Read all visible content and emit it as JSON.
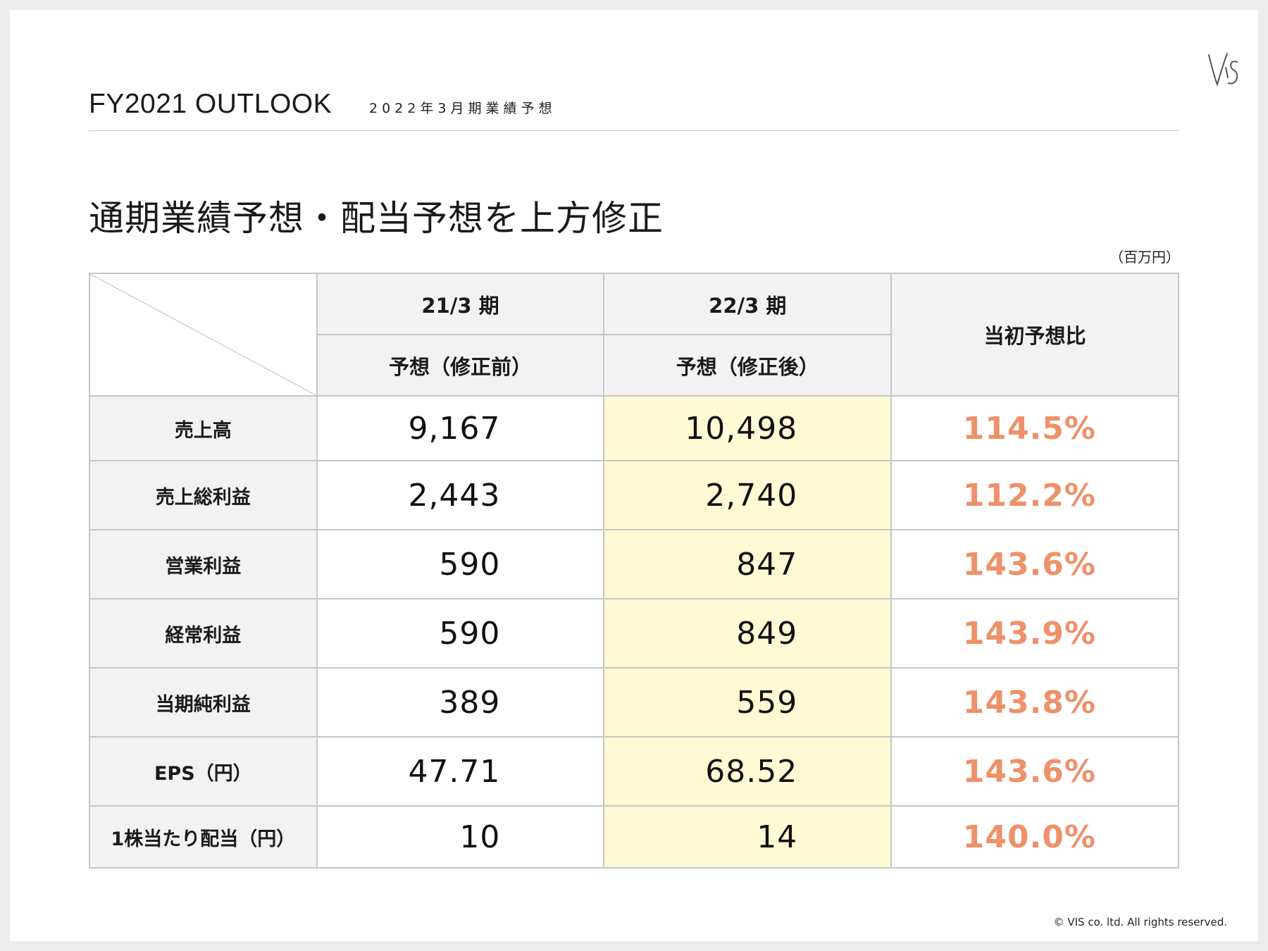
{
  "header": {
    "title_en": "FY2021 OUTLOOK",
    "title_jp": "2022年3月期業績予想"
  },
  "headline": "通期業績予想・配当予想を上方修正",
  "unit": "（百万円）",
  "table": {
    "col1_top": "21/3 期",
    "col1_sub": "予想（修正前）",
    "col2_top": "22/3 期",
    "col2_sub": "予想（修正後）",
    "col3": "当初予想比",
    "rows": [
      {
        "label": "売上高",
        "before": "9,167",
        "after": "10,498",
        "ratio": "114.5%"
      },
      {
        "label": "売上総利益",
        "before": "2,443",
        "after": "2,740",
        "ratio": "112.2%"
      },
      {
        "label": "営業利益",
        "before": "590",
        "after": "847",
        "ratio": "143.6%"
      },
      {
        "label": "経常利益",
        "before": "590",
        "after": "849",
        "ratio": "143.9%"
      },
      {
        "label": "当期純利益",
        "before": "389",
        "after": "559",
        "ratio": "143.8%"
      },
      {
        "label": "EPS（円）",
        "before": "47.71",
        "after": "68.52",
        "ratio": "143.6%"
      },
      {
        "label": "1株当たり配当（円）",
        "before": "10",
        "after": "14",
        "ratio": "140.0%"
      }
    ]
  },
  "footer": {
    "copyright": "© VIS co. ltd. All rights reserved."
  },
  "colors": {
    "highlight_column": "#fefad3",
    "ratio_text": "#ee916a",
    "header_bg": "#f2f2f2"
  },
  "logo": {
    "name": "vis-logo",
    "text": "VIS"
  }
}
